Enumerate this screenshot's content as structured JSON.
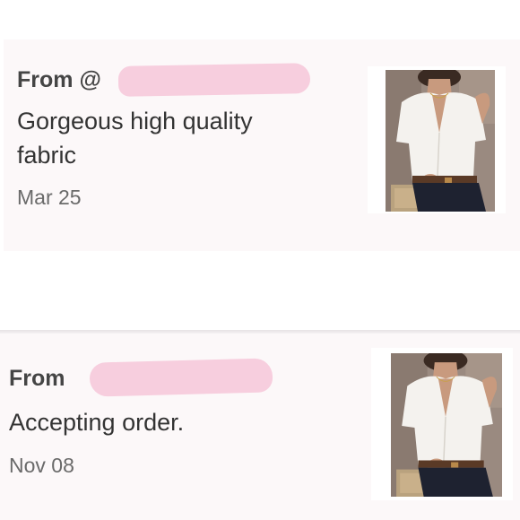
{
  "reviews": [
    {
      "from_prefix": "From @",
      "message": "Gorgeous high quality fabric",
      "date": "Mar 25",
      "photo_icon": "product-photo-white-shirt"
    },
    {
      "from_prefix": "From",
      "message": "Accepting order.",
      "date": "Nov 08",
      "photo_icon": "product-photo-white-shirt"
    }
  ],
  "colors": {
    "card_background": "#fcf8f9",
    "redaction": "#f7cede",
    "text_primary": "#333333",
    "text_secondary": "#6a6a6a"
  }
}
